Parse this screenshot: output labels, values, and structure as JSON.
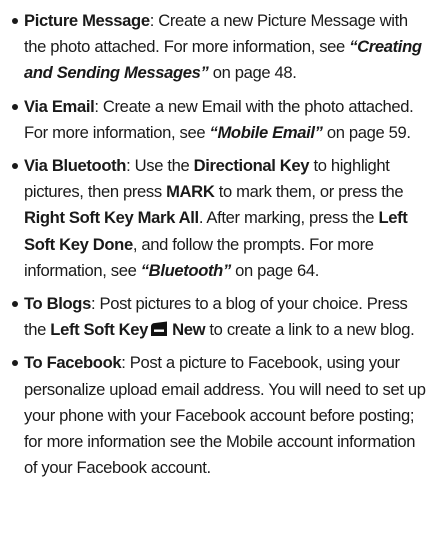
{
  "items": [
    {
      "term": "Picture Message",
      "sep": ": ",
      "text1": "Create a new Picture Message with the photo attached. For more information, see ",
      "ref": "“Creating and Sending Messages”",
      "text2": " on page 48."
    },
    {
      "term": "Via Email",
      "sep": ": ",
      "text1": "Create a new Email with the photo attached. For more information, see ",
      "ref": "“Mobile Email”",
      "text2": " on page 59."
    },
    {
      "term": "Via Bluetooth",
      "sep": ": Use the ",
      "key1": "Directional Key",
      "t1": " to highlight pictures, then press ",
      "key2": "MARK",
      "t2": " to mark them, or press the ",
      "key3": "Right Soft Key Mark All",
      "t3": ". After marking, press the ",
      "key4": "Left Soft Key Done",
      "t4": ", and follow the prompts. For more information, see ",
      "ref": "“Bluetooth”",
      "t5": " on page 64."
    },
    {
      "term": "To Blogs",
      "sep": ": Post pictures to a blog of your choice. Press the ",
      "key1": "Left Soft Key",
      "icon": "left-soft-key-icon",
      "key2": "New",
      "t2": " to create a link to a new blog."
    },
    {
      "term": "To Facebook",
      "sep": ": ",
      "text1": "Post a picture to Facebook, using your personalize upload email address. You will need to set up your phone with your Facebook account before posting; for more information see the Mobile account information of your Facebook account."
    }
  ]
}
